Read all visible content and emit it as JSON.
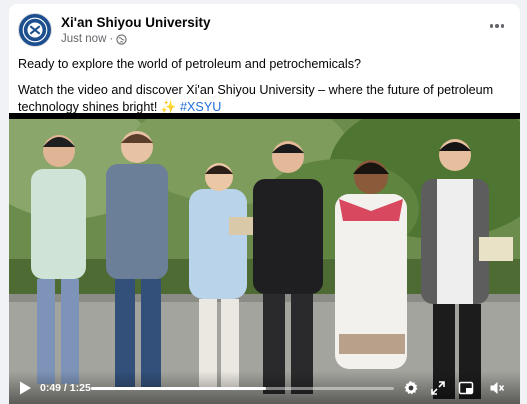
{
  "post": {
    "author": "Xi'an Shiyou University",
    "timestamp": "Just now",
    "separator": "·",
    "privacy_icon": "globe-icon",
    "text_line1": "Ready to explore the world of petroleum and petrochemicals?",
    "text_line2": "Watch the video and discover Xi'an Shiyou University – where the future of petroleum technology shines bright!",
    "sparkle": "✨",
    "hashtag": "#XSYU"
  },
  "video": {
    "current_time": "0:49",
    "time_separator": " / ",
    "duration": "1:25",
    "progress": 0.576,
    "controls": [
      "play-icon",
      "settings-icon",
      "fullscreen-icon",
      "pip-icon",
      "volume-icon"
    ]
  },
  "colors": {
    "hashtag": "#216fdb",
    "author": "#050505",
    "meta": "#65676b",
    "avatar": "#1d4f8f"
  }
}
